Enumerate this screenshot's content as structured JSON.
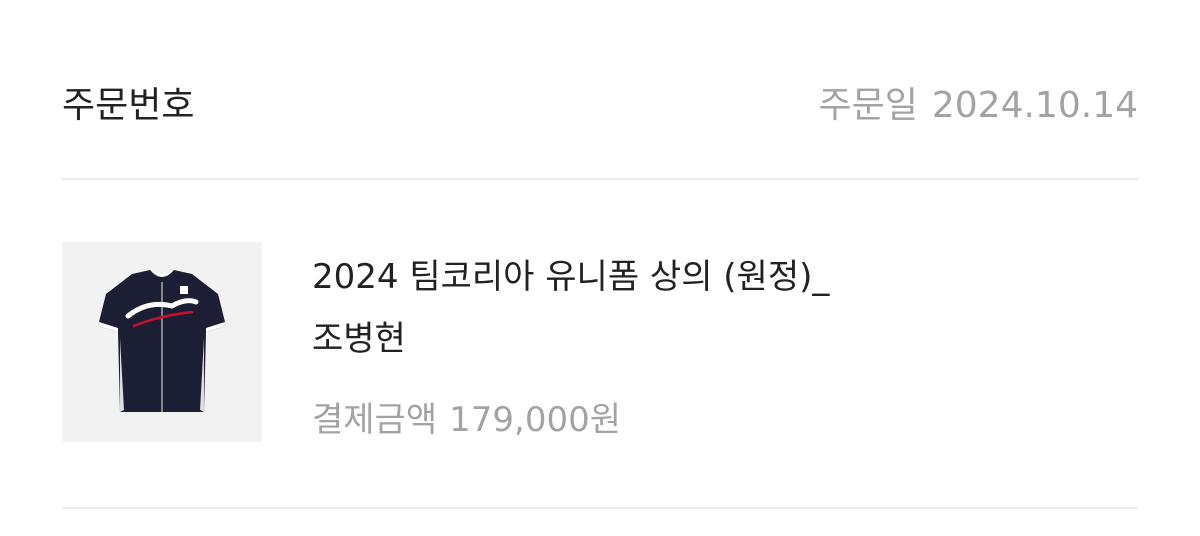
{
  "order": {
    "number_label": "주문번호",
    "date_label": "주문일",
    "date_value": "2024.10.14"
  },
  "product": {
    "image_icon": "jersey-image",
    "title_line1": "2024 팀코리아 유니폼 상의 (원정)_",
    "title_line2": "조병현",
    "payment_label": "결제금액",
    "payment_value": "179,000원"
  },
  "colors": {
    "primary_text": "#222222",
    "secondary_text": "#a3a3a3",
    "divider": "#ececec",
    "thumbnail_bg": "#f2f2f2",
    "jersey_navy": "#1c1f33"
  }
}
